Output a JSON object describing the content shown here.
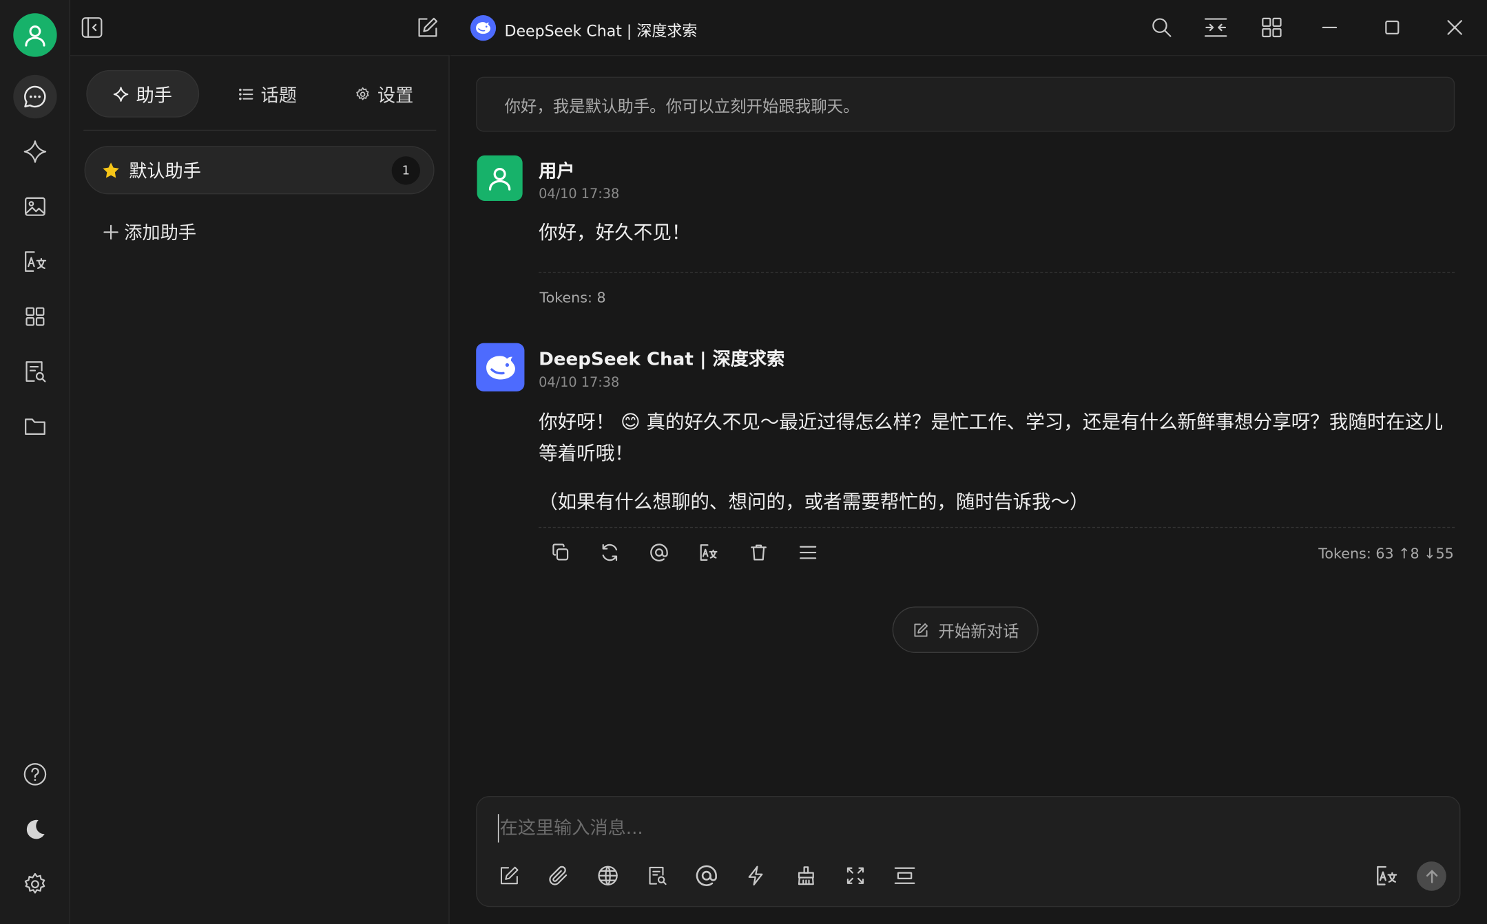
{
  "window": {
    "title": "DeepSeek Chat | 深度求索"
  },
  "rail": {
    "items": [
      "chat-icon",
      "sparkle-icon",
      "image-icon",
      "translate-icon",
      "apps-icon",
      "document-search-icon",
      "folder-icon"
    ],
    "bottom": [
      "help-icon",
      "moon-icon",
      "gear-icon"
    ]
  },
  "sidepanel": {
    "tabs": [
      {
        "label": "助手",
        "icon": "sparkle-icon",
        "active": true
      },
      {
        "label": "话题",
        "icon": "list-icon",
        "active": false
      },
      {
        "label": "设置",
        "icon": "gear-icon",
        "active": false
      }
    ],
    "assistant": {
      "name": "默认助手",
      "count": "1",
      "icon": "star-icon"
    },
    "add_label": "添加助手"
  },
  "chat": {
    "greeting": "你好，我是默认助手。你可以立刻开始跟我聊天。",
    "messages": [
      {
        "name": "用户",
        "time": "04/10 17:38",
        "text": "你好，好久不见！",
        "tokens": "Tokens: 8"
      },
      {
        "name": "DeepSeek Chat | 深度求索",
        "time": "04/10 17:38",
        "text1_before": "你好呀！",
        "emoji": "😊",
        "text1_after": "真的好久不见～最近过得怎么样？是忙工作、学习，还是有什么新鲜事想分享呀？我随时在这儿等着听哦！",
        "text2": "（如果有什么想聊的、想问的，或者需要帮忙的，随时告诉我～）",
        "tokens": "Tokens: 63 ↑8 ↓55"
      }
    ],
    "new_chat_label": "开始新对话"
  },
  "composer": {
    "placeholder": "在这里输入消息..."
  },
  "colors": {
    "accent_green": "#17b26a",
    "deepseek_blue": "#4d6bfe",
    "background": "#181818"
  }
}
